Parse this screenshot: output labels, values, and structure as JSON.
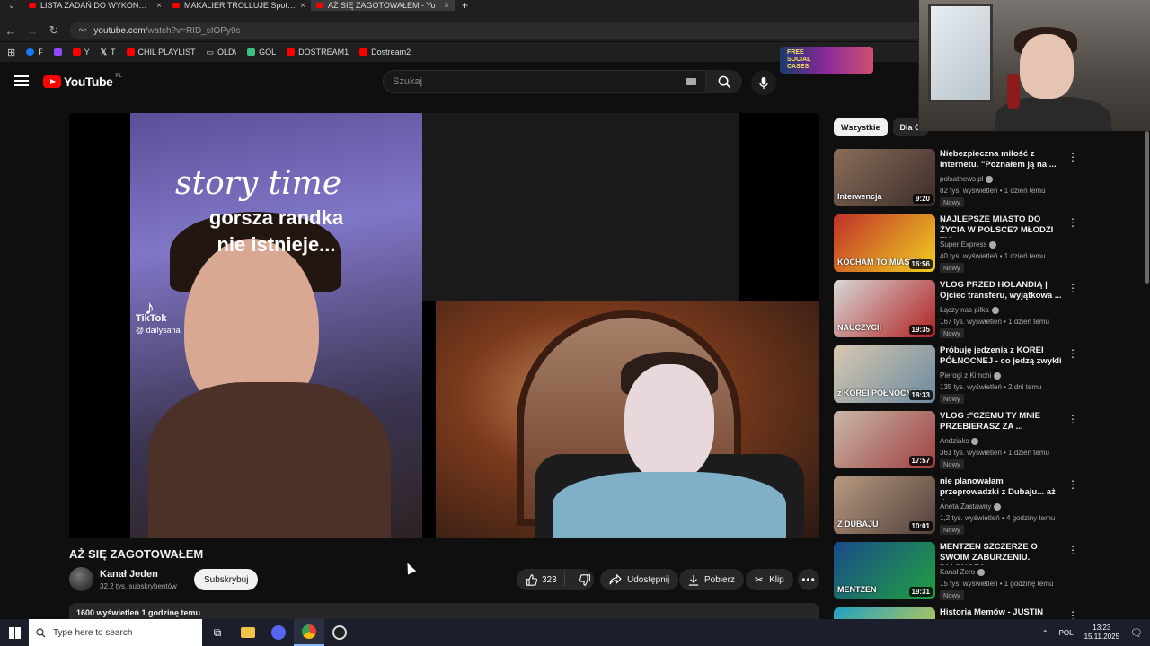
{
  "browser": {
    "tabs": [
      {
        "label": "LISTA ZADAŃ DO WYKONANIA"
      },
      {
        "label": "MAKALIER TROLLUJE Spotkani"
      },
      {
        "label": "AŻ SIĘ ZAGOTOWAŁEM - Yo"
      }
    ],
    "url": "youtube.com",
    "url_rest": "/watch?v=RID_sIOPy9s",
    "bookmarks": [
      {
        "label": "F",
        "color": "#1877f2"
      },
      {
        "label": "",
        "color": "#9146ff"
      },
      {
        "label": "Y",
        "color": "#ff0000"
      },
      {
        "label": "T",
        "color": "#ffffff"
      },
      {
        "label": "CHIL PLAYLIST",
        "color": "#ff0000"
      },
      {
        "label": "OLD\\",
        "color": "#cccccc"
      },
      {
        "label": "GOL",
        "color": "#3fbf7f"
      },
      {
        "label": "DOSTREAM1",
        "color": "#ff0000"
      },
      {
        "label": "Dostream2",
        "color": "#ff0000"
      }
    ]
  },
  "yt": {
    "logo_text": "YouTube",
    "logo_cc": "PL",
    "search_placeholder": "Szukaj",
    "promo_text_1": "FREE",
    "promo_text_2": "SOCIAL",
    "promo_text_3": "CASES"
  },
  "video": {
    "overlay_line1": "story time",
    "overlay_line2": "gorsza randka",
    "overlay_line3": "nie istnieje...",
    "tiktok_label": "TikTok",
    "tiktok_handle": "@ dailysana",
    "title": "AŻ SIĘ ZAGOTOWAŁEM",
    "channel": "Kanał Jeden",
    "subscribers": "32,2 tys. subskrybentów",
    "subscribe_label": "Subskrybuj",
    "likes": "323",
    "share_label": "Udostępnij",
    "download_label": "Pobierz",
    "clip_label": "Klip",
    "description_meta": "1600 wyświetleń  1 godzinę temu"
  },
  "sidebar": {
    "chips": [
      "Wszystkie",
      "Dla C"
    ],
    "recommendations": [
      {
        "title": "Niebezpieczna miłość z internetu. \"Poznałem ją na ...",
        "channel": "polsatnews.pl",
        "meta": "82 tys. wyświetleń • 1 dzień temu",
        "badge": "Nowy",
        "duration": "9:20",
        "caption": "Interwencja",
        "colors": [
          "#8a6d5a",
          "#3a2d28"
        ]
      },
      {
        "title": "NAJLEPSZE MIASTO DO ŻYCIA W POLSCE? MŁODZI TU ...",
        "channel": "Super Express",
        "meta": "40 tys. wyświetleń • 1 dzień temu",
        "badge": "Nowy",
        "duration": "16:56",
        "caption": "KOCHAM TO MIASTO!",
        "colors": [
          "#c0302a",
          "#f0d020"
        ]
      },
      {
        "title": "VLOG PRZED HOLANDIĄ | Ojciec transferu, wyjątkowa ...",
        "channel": "Łączy nas piłka",
        "meta": "167 tys. wyświetleń • 1 dzień temu",
        "badge": "Nowy",
        "duration": "19:35",
        "caption": "NAUCZYCII",
        "colors": [
          "#d8d8d8",
          "#b02020"
        ]
      },
      {
        "title": "Próbuję jedzenia z KOREI PÓŁNOCNEJ - co jedzą zwykli ...",
        "channel": "Pierogi z Kimchi",
        "meta": "135 tys. wyświetleń • 2 dni temu",
        "badge": "Nowy",
        "duration": "18:33",
        "caption": "z KOREI PÓŁNOCNEJ",
        "colors": [
          "#d8c8b0",
          "#6a8aa0"
        ]
      },
      {
        "title": "VLOG :\"CZEMU TY MNIE PRZEBIERASZ ZA ...",
        "channel": "Andziaks",
        "meta": "361 tys. wyświetleń • 1 dzień temu",
        "badge": "Nowy",
        "duration": "17:57",
        "caption": "",
        "colors": [
          "#c8b8a8",
          "#a04040"
        ]
      },
      {
        "title": "nie planowałam przeprowadzki z Dubaju... aż do teraz",
        "channel": "Aneta Zastawny",
        "meta": "1,2 tys. wyświetleń • 4 godziny temu",
        "badge": "Nowy",
        "duration": "10:01",
        "caption": "Z DUBAJU",
        "colors": [
          "#b89a80",
          "#50403a"
        ]
      },
      {
        "title": "MENTZEN SZCZERZE O SWOIM ZABURZENIU. DIAGNOZA, ...",
        "channel": "Kanał Zero",
        "meta": "15 tys. wyświetleń • 1 godzinę temu",
        "badge": "Nowy",
        "duration": "19:31",
        "caption": "MENTZEN",
        "colors": [
          "#1a4a8a",
          "#20a040"
        ]
      },
      {
        "title": "Historia Memów - JUSTIN",
        "channel": "",
        "meta": "",
        "badge": "",
        "duration": "",
        "caption": "",
        "colors": [
          "#20a0c0",
          "#e0d040"
        ]
      }
    ]
  },
  "taskbar": {
    "search_placeholder": "Type here to search",
    "lang": "POL",
    "time": "13:23",
    "date": "15.11.2025"
  }
}
